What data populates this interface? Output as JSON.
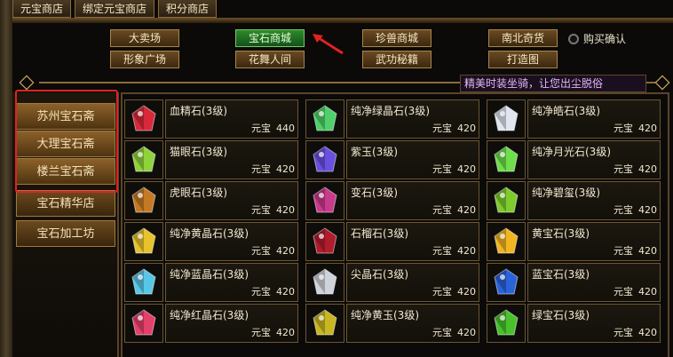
{
  "top_tabs": [
    "元宝商店",
    "绑定元宝商店",
    "积分商店"
  ],
  "categories": [
    {
      "label": "大卖场",
      "active": false
    },
    {
      "label": "宝石商城",
      "active": true
    },
    {
      "label": "珍兽商城",
      "active": false
    },
    {
      "label": "南北奇货",
      "active": false
    },
    {
      "label": "形象广场",
      "active": false
    },
    {
      "label": "花舞人间",
      "active": false
    },
    {
      "label": "武功秘籍",
      "active": false
    },
    {
      "label": "打造图",
      "active": false
    }
  ],
  "purchase_confirm": {
    "label": "购买确认",
    "checked": false
  },
  "marquee_text": "精美时装坐骑，让您出尘脱俗",
  "shops": [
    {
      "label": "苏州宝石斋"
    },
    {
      "label": "大理宝石斋"
    },
    {
      "label": "楼兰宝石斋"
    },
    {
      "label": "宝石精华店"
    },
    {
      "label": "宝石加工坊"
    }
  ],
  "currency_label": "元宝",
  "items": [
    {
      "name": "血精石(3级)",
      "price": "440",
      "color": "#d8283a",
      "icon": "red-gem-icon"
    },
    {
      "name": "纯净绿晶石(3级)",
      "price": "420",
      "color": "#4fd06a",
      "icon": "green-crystal-icon"
    },
    {
      "name": "纯净皓石(3级)",
      "price": "420",
      "color": "#dfe6f0",
      "icon": "white-gem-icon"
    },
    {
      "name": "猫眼石(3级)",
      "price": "420",
      "color": "#8fd23a",
      "icon": "cat-eye-gem-icon"
    },
    {
      "name": "紫玉(3级)",
      "price": "420",
      "color": "#6a4fe0",
      "icon": "purple-jade-icon"
    },
    {
      "name": "纯净月光石(3级)",
      "price": "420",
      "color": "#6ede4a",
      "icon": "moonstone-icon"
    },
    {
      "name": "虎眼石(3级)",
      "price": "420",
      "color": "#c47a25",
      "icon": "tiger-eye-icon"
    },
    {
      "name": "变石(3级)",
      "price": "420",
      "color": "#c93a8a",
      "icon": "alexandrite-icon"
    },
    {
      "name": "纯净碧玺(3级)",
      "price": "420",
      "color": "#7ecb2c",
      "icon": "tourmaline-icon"
    },
    {
      "name": "纯净黄晶石(3级)",
      "price": "420",
      "color": "#e7c22c",
      "icon": "yellow-crystal-icon"
    },
    {
      "name": "石榴石(3级)",
      "price": "420",
      "color": "#b01c2c",
      "icon": "garnet-icon"
    },
    {
      "name": "黄宝石(3级)",
      "price": "420",
      "color": "#f0b521",
      "icon": "topaz-icon"
    },
    {
      "name": "纯净蓝晶石(3级)",
      "price": "420",
      "color": "#58c7e6",
      "icon": "blue-crystal-icon"
    },
    {
      "name": "尖晶石(3级)",
      "price": "420",
      "color": "#cfd3da",
      "icon": "spinel-icon"
    },
    {
      "name": "蓝宝石(3级)",
      "price": "420",
      "color": "#2a62d8",
      "icon": "sapphire-icon"
    },
    {
      "name": "纯净红晶石(3级)",
      "price": "420",
      "color": "#e4406a",
      "icon": "red-crystal-icon"
    },
    {
      "name": "纯净黄玉(3级)",
      "price": "420",
      "color": "#c8b622",
      "icon": "yellow-jade-icon"
    },
    {
      "name": "绿宝石(3级)",
      "price": "420",
      "color": "#49c12c",
      "icon": "emerald-icon"
    }
  ],
  "colors": {
    "gold_border": "#a98547",
    "active_green": "#2f8a2c",
    "highlight_red": "#e02222"
  }
}
